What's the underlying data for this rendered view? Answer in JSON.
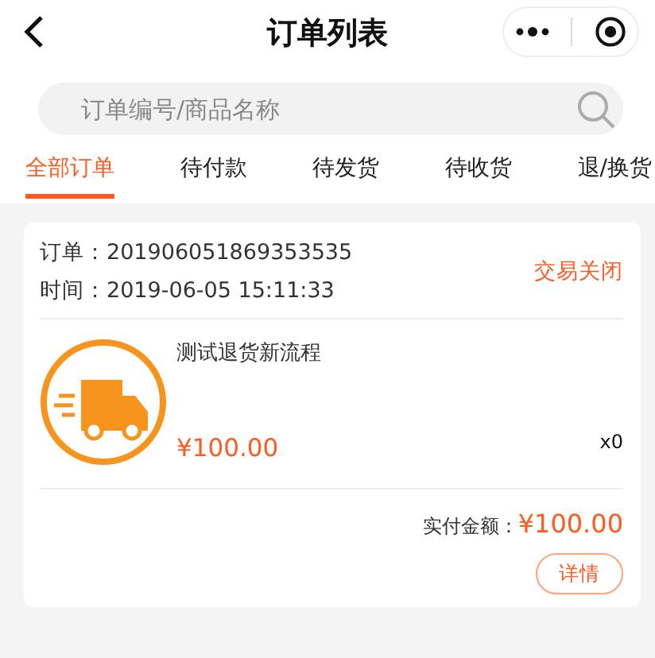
{
  "header": {
    "title": "订单列表"
  },
  "search": {
    "placeholder": "订单编号/商品名称"
  },
  "tabs": [
    {
      "label": "全部订单",
      "selected": true
    },
    {
      "label": "待付款",
      "selected": false
    },
    {
      "label": "待发货",
      "selected": false
    },
    {
      "label": "待收货",
      "selected": false
    },
    {
      "label": "退/换货",
      "selected": false
    }
  ],
  "orders": [
    {
      "order_label": "订单：",
      "order_no": "201906051869353535",
      "time_label": "时间：",
      "time": "2019-06-05 15:11:33",
      "status": "交易关闭",
      "product": {
        "name": "测试退货新流程",
        "price": "¥100.00",
        "quantity": "x0"
      },
      "total_label": "实付金额：",
      "total": "¥100.00",
      "action": "详情"
    }
  ]
}
